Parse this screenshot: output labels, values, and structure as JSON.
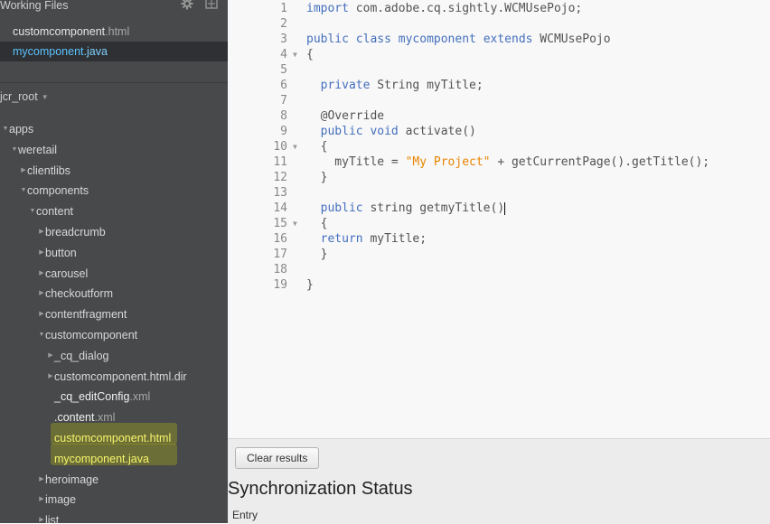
{
  "sidebar": {
    "working_files_title": "Working Files",
    "working_files": [
      {
        "name": "customcomponent",
        "ext": ".html",
        "active": false
      },
      {
        "name": "mycomponent",
        "ext": ".java",
        "active": true
      }
    ],
    "root_label": "jcr_root",
    "tree": [
      {
        "label": "apps",
        "ext": "",
        "depth": 0,
        "type": "folder-open"
      },
      {
        "label": "weretail",
        "ext": "",
        "depth": 1,
        "type": "folder-open"
      },
      {
        "label": "clientlibs",
        "ext": "",
        "depth": 2,
        "type": "folder"
      },
      {
        "label": "components",
        "ext": "",
        "depth": 2,
        "type": "folder-open"
      },
      {
        "label": "content",
        "ext": "",
        "depth": 3,
        "type": "folder-open"
      },
      {
        "label": "breadcrumb",
        "ext": "",
        "depth": 4,
        "type": "folder"
      },
      {
        "label": "button",
        "ext": "",
        "depth": 4,
        "type": "folder"
      },
      {
        "label": "carousel",
        "ext": "",
        "depth": 4,
        "type": "folder"
      },
      {
        "label": "checkoutform",
        "ext": "",
        "depth": 4,
        "type": "folder"
      },
      {
        "label": "contentfragment",
        "ext": "",
        "depth": 4,
        "type": "folder"
      },
      {
        "label": "customcomponent",
        "ext": "",
        "depth": 4,
        "type": "folder-open"
      },
      {
        "label": "_cq_dialog",
        "ext": "",
        "depth": 5,
        "type": "folder"
      },
      {
        "label": "customcomponent.html.dir",
        "ext": "",
        "depth": 5,
        "type": "folder"
      },
      {
        "label": "_cq_editConfig",
        "ext": ".xml",
        "depth": 5,
        "type": "file"
      },
      {
        "label": ".content",
        "ext": ".xml",
        "depth": 5,
        "type": "file"
      },
      {
        "label": "customcomponent",
        "ext": ".html",
        "depth": 5,
        "type": "file-hl"
      },
      {
        "label": "mycomponent",
        "ext": ".java",
        "depth": 5,
        "type": "file-hl"
      },
      {
        "label": "heroimage",
        "ext": "",
        "depth": 4,
        "type": "folder"
      },
      {
        "label": "image",
        "ext": "",
        "depth": 4,
        "type": "folder"
      },
      {
        "label": "list",
        "ext": "",
        "depth": 4,
        "type": "folder"
      }
    ]
  },
  "editor": {
    "lines": [
      {
        "n": "1",
        "fold": "",
        "tokens": [
          {
            "t": "import",
            "c": "kw"
          },
          {
            "t": " com.adobe.cq.sightly.WCMUsePojo;",
            "c": ""
          }
        ]
      },
      {
        "n": "2",
        "fold": "",
        "tokens": []
      },
      {
        "n": "3",
        "fold": "",
        "tokens": [
          {
            "t": "public",
            "c": "kw"
          },
          {
            "t": " ",
            "c": ""
          },
          {
            "t": "class",
            "c": "kw"
          },
          {
            "t": " ",
            "c": ""
          },
          {
            "t": "mycomponent",
            "c": "kw"
          },
          {
            "t": " ",
            "c": ""
          },
          {
            "t": "extends",
            "c": "kw"
          },
          {
            "t": " WCMUsePojo",
            "c": ""
          }
        ]
      },
      {
        "n": "4",
        "fold": "▼",
        "tokens": [
          {
            "t": "{",
            "c": ""
          }
        ]
      },
      {
        "n": "5",
        "fold": "",
        "tokens": []
      },
      {
        "n": "6",
        "fold": "",
        "tokens": [
          {
            "t": "  ",
            "c": ""
          },
          {
            "t": "private",
            "c": "kw"
          },
          {
            "t": " String myTitle;",
            "c": ""
          }
        ]
      },
      {
        "n": "7",
        "fold": "",
        "tokens": []
      },
      {
        "n": "8",
        "fold": "",
        "tokens": [
          {
            "t": "  @Override",
            "c": ""
          }
        ]
      },
      {
        "n": "9",
        "fold": "",
        "tokens": [
          {
            "t": "  ",
            "c": ""
          },
          {
            "t": "public",
            "c": "kw"
          },
          {
            "t": " ",
            "c": ""
          },
          {
            "t": "void",
            "c": "kw"
          },
          {
            "t": " activate()",
            "c": ""
          }
        ]
      },
      {
        "n": "10",
        "fold": "▼",
        "tokens": [
          {
            "t": "  {",
            "c": ""
          }
        ]
      },
      {
        "n": "11",
        "fold": "",
        "tokens": [
          {
            "t": "    myTitle = ",
            "c": ""
          },
          {
            "t": "\"My Project\"",
            "c": "str"
          },
          {
            "t": " + getCurrentPage().getTitle();",
            "c": ""
          }
        ]
      },
      {
        "n": "12",
        "fold": "",
        "tokens": [
          {
            "t": "  }",
            "c": ""
          }
        ]
      },
      {
        "n": "13",
        "fold": "",
        "tokens": []
      },
      {
        "n": "14",
        "fold": "",
        "tokens": [
          {
            "t": "  ",
            "c": ""
          },
          {
            "t": "public",
            "c": "kw"
          },
          {
            "t": " string getmyTitle()",
            "c": ""
          }
        ],
        "cursor": true
      },
      {
        "n": "15",
        "fold": "▼",
        "tokens": [
          {
            "t": "  {",
            "c": ""
          }
        ]
      },
      {
        "n": "16",
        "fold": "",
        "tokens": [
          {
            "t": "  ",
            "c": ""
          },
          {
            "t": "return",
            "c": "kw"
          },
          {
            "t": " myTitle;",
            "c": ""
          }
        ]
      },
      {
        "n": "17",
        "fold": "",
        "tokens": [
          {
            "t": "  }",
            "c": ""
          }
        ]
      },
      {
        "n": "18",
        "fold": "",
        "tokens": []
      },
      {
        "n": "19",
        "fold": "",
        "tokens": [
          {
            "t": "}",
            "c": ""
          }
        ]
      }
    ]
  },
  "bottom": {
    "clear_label": "Clear results",
    "sync_title": "Synchronization Status",
    "column_entry": "Entry"
  },
  "icons": {
    "gear": "gear-icon",
    "split": "split-view-icon"
  },
  "colors": {
    "sidebar_bg": "#47494b",
    "active_blue": "#5bc2ff",
    "highlight": "#f8f56d",
    "keyword": "#446fbd",
    "string": "#e88501"
  }
}
